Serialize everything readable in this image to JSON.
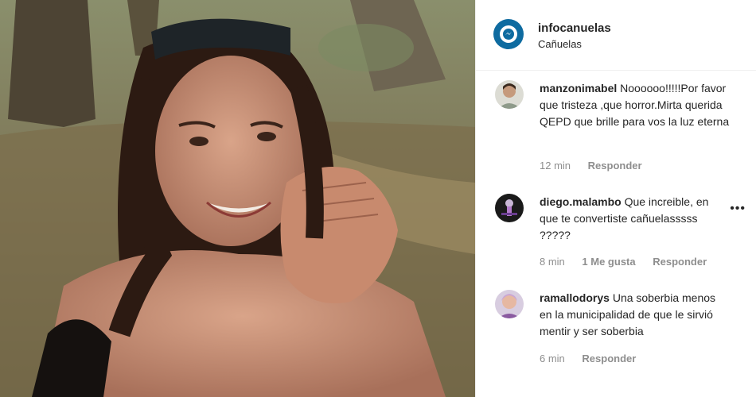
{
  "post": {
    "username": "infocanuelas",
    "location": "Cañuelas",
    "photo": {
      "kind": "photo",
      "description_icon": "woman-portrait-photo"
    }
  },
  "comments": [
    {
      "user": "manzonimabel",
      "text": "Noooooo!!!!!Por favor que tristeza ,que horror.Mirta querida QEPD que brille para vos la luz eterna",
      "time": "12 min",
      "likes": "",
      "reply": "Responder"
    },
    {
      "user": "diego.malambo",
      "text": "Que increible, en que te convertiste cañuelasssss ?????",
      "time": "8 min",
      "likes": "1 Me gusta",
      "reply": "Responder",
      "more": "•••"
    },
    {
      "user": "ramallodorys",
      "text": "Una soberbia menos en la municipalidad de que le sirvió mentir y ser soberbia",
      "time": "6 min",
      "likes": "",
      "reply": "Responder"
    }
  ],
  "colors": {
    "brand": "#0e6ba0",
    "meta_text": "#8e8e8e",
    "text": "#262626"
  }
}
